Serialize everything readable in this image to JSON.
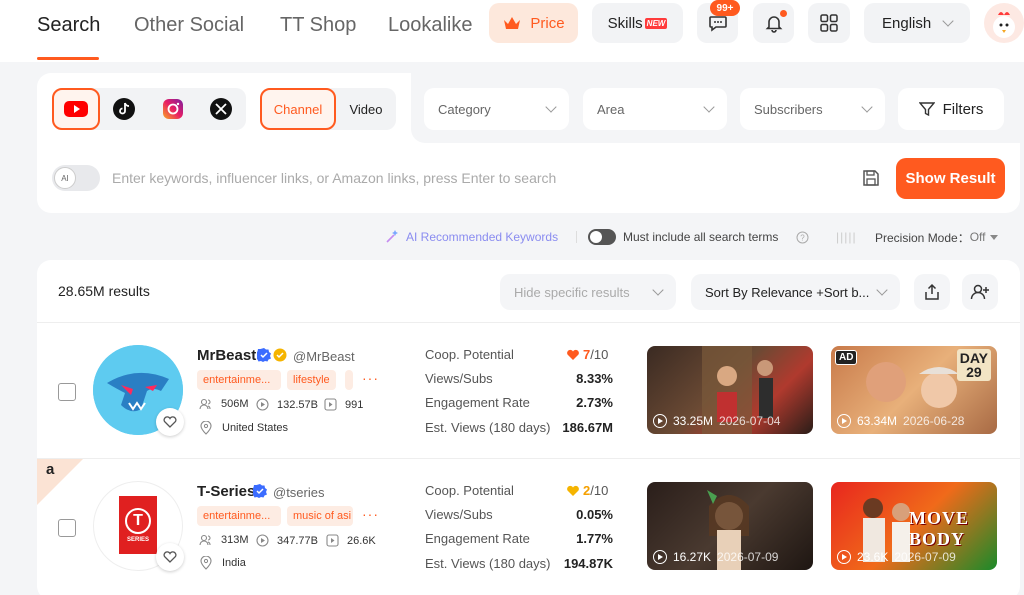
{
  "nav": {
    "tabs": [
      "Search",
      "Other Social",
      "TT Shop",
      "Lookalike"
    ],
    "price": "Price",
    "skills": "Skills",
    "skills_badge": "NEW",
    "messages_badge": "99+",
    "language": "English"
  },
  "search": {
    "platforms": [
      "youtube",
      "tiktok",
      "instagram",
      "x"
    ],
    "selected_platform": "youtube",
    "modes": [
      "Channel",
      "Video"
    ],
    "selected_mode": "Channel",
    "category": "Category",
    "area": "Area",
    "subscribers": "Subscribers",
    "filters": "Filters",
    "ai_toggle_label": "AI",
    "placeholder": "Enter keywords, influencer links, or Amazon links, press Enter to search",
    "show_result": "Show Result"
  },
  "options": {
    "ai_keywords": "AI Recommended Keywords",
    "must_include": "Must include all search terms",
    "precision_label": "Precision Mode：",
    "precision_value": "Off"
  },
  "results": {
    "count": "28.65M results",
    "hide_placeholder": "Hide specific results",
    "sort": "Sort By Relevance +Sort b...",
    "rows": [
      {
        "name": "MrBeast",
        "handle": "@MrBeast",
        "tags": [
          "entertainme...",
          "lifestyle"
        ],
        "subscribers": "506M",
        "views": "132.57B",
        "videos": "991",
        "country": "United States",
        "metrics": {
          "coop_label": "Coop. Potential",
          "coop_value": "7",
          "coop_max": "/10",
          "views_subs_label": "Views/Subs",
          "views_subs": "8.33%",
          "engagement_label": "Engagement Rate",
          "engagement": "2.73%",
          "est_views_label": "Est. Views (180 days)",
          "est_views": "186.67M"
        },
        "videos_list": [
          {
            "views": "33.25M",
            "date": "2026-07-04"
          },
          {
            "views": "63.34M",
            "date": "2026-06-28",
            "ad": "AD",
            "day_label": "DAY",
            "day_num": "29"
          }
        ]
      },
      {
        "name": "T-Series",
        "handle": "@tseries",
        "tags": [
          "entertainme...",
          "music of asi"
        ],
        "subscribers": "313M",
        "views": "347.77B",
        "videos": "26.6K",
        "country": "India",
        "amazon_mark": "a",
        "logo_text": "T",
        "logo_sub": "SERIES",
        "metrics": {
          "coop_label": "Coop. Potential",
          "coop_value": "2",
          "coop_max": "/10",
          "views_subs_label": "Views/Subs",
          "views_subs": "0.05%",
          "engagement_label": "Engagement Rate",
          "engagement": "1.77%",
          "est_views_label": "Est. Views (180 days)",
          "est_views": "194.87K"
        },
        "videos_list": [
          {
            "views": "16.27K",
            "date": "2026-07-09"
          },
          {
            "views": "23.6K",
            "date": "2026-07-09",
            "title": "MOVE BODY"
          }
        ]
      }
    ]
  },
  "colors": {
    "accent": "#ff5a1f",
    "verified": "#3b6cff",
    "gold": "#f5b400"
  }
}
